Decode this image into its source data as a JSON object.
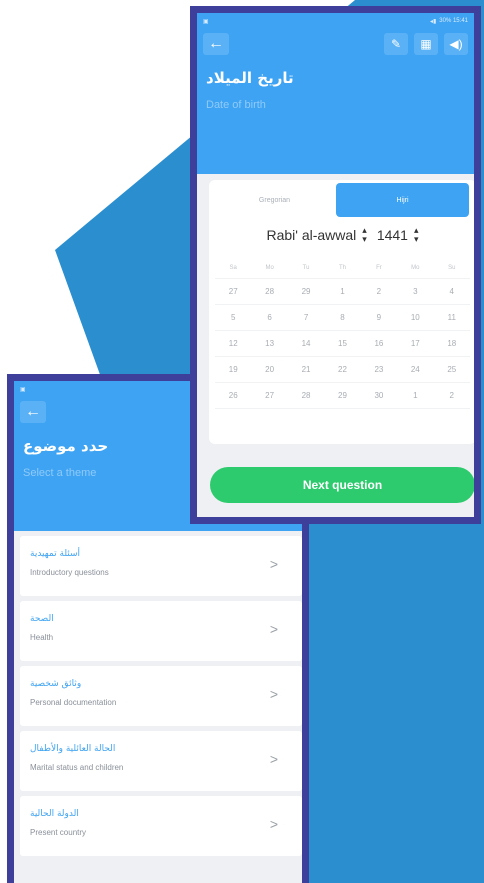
{
  "colors": {
    "accent": "#3ea3f2",
    "frame": "#3d3f9a",
    "backdrop": "#2a8ecf",
    "success": "#2ecb6e"
  },
  "front": {
    "status": {
      "right_text": "30% 15:41"
    },
    "icons": [
      "back-arrow-icon",
      "edit-icon",
      "calendar-icon",
      "speaker-icon"
    ],
    "title_ar": "تاريخ الميلاد",
    "subtitle": "Date of birth",
    "tabs": [
      "Gregorian",
      "Hijri"
    ],
    "selected_tab": "Hijri",
    "month": "Rabi' al-awwal",
    "year": "1441",
    "weekdays": [
      "Sa",
      "Mo",
      "Tu",
      "Th",
      "Fr",
      "Mo",
      "Su"
    ],
    "weeks": [
      [
        "27",
        "28",
        "29",
        "1",
        "2",
        "3",
        "4"
      ],
      [
        "5",
        "6",
        "7",
        "8",
        "9",
        "10",
        "11"
      ],
      [
        "12",
        "13",
        "14",
        "15",
        "16",
        "17",
        "18"
      ],
      [
        "19",
        "20",
        "21",
        "22",
        "23",
        "24",
        "25"
      ],
      [
        "26",
        "27",
        "28",
        "29",
        "30",
        "1",
        "2"
      ]
    ],
    "next_label": "Next question"
  },
  "back": {
    "title_ar": "حدد موضوع",
    "subtitle": "Select a theme",
    "items": [
      {
        "ar": "أسئلة تمهيدية",
        "en": "Introductory questions"
      },
      {
        "ar": "الصحة",
        "en": "Health"
      },
      {
        "ar": "وثائق شخصية",
        "en": "Personal documentation"
      },
      {
        "ar": "الحالة العائلية والأطفال",
        "en": "Marital status and children"
      },
      {
        "ar": "الدولة الحالية",
        "en": "Present country"
      }
    ]
  }
}
